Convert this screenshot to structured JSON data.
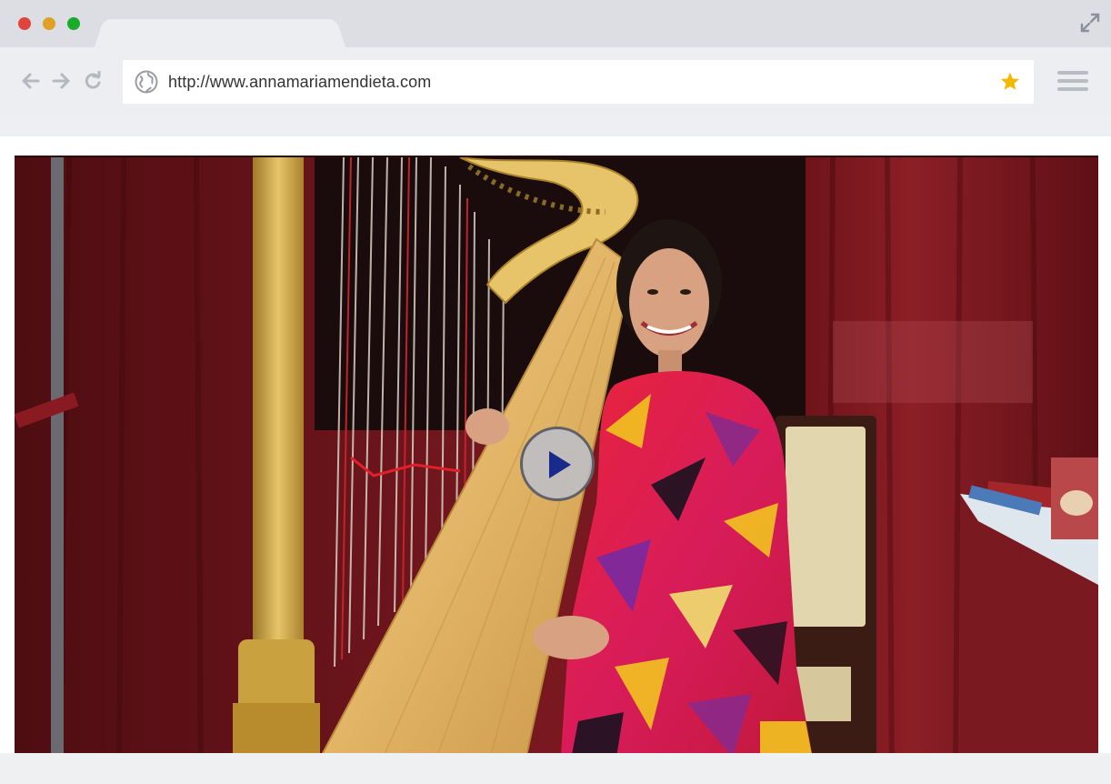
{
  "browser": {
    "url": "http://www.annamariamendieta.com",
    "icons": {
      "close": "close-dot",
      "minimize": "minimize-dot",
      "maximize": "maximize-dot",
      "fullscreen": "expand-icon",
      "back": "arrow-left-icon",
      "forward": "arrow-right-icon",
      "reload": "reload-icon",
      "site": "globe-icon",
      "bookmark": "star-icon",
      "menu": "hamburger-menu-icon"
    },
    "colors": {
      "close": "#e0443e",
      "minimize": "#dea123",
      "maximize": "#1aab29",
      "bookmark": "#f5b800"
    }
  },
  "video": {
    "thumbnail": "woman in colorful dress seated at a golden concert harp in front of red curtains",
    "play_icon": "play-icon",
    "play_color": "#1a2a8a"
  }
}
